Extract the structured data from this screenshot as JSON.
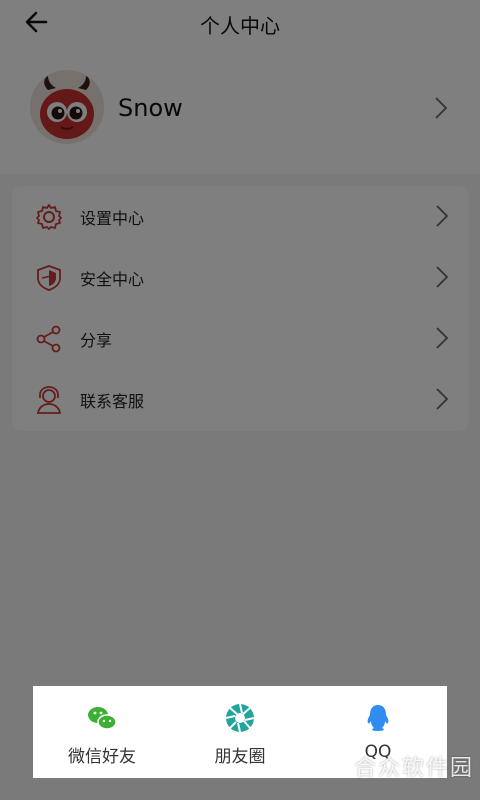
{
  "header": {
    "title": "个人中心"
  },
  "profile": {
    "username": "Snow"
  },
  "menu": [
    {
      "label": "设置中心",
      "icon": "gear-icon"
    },
    {
      "label": "安全中心",
      "icon": "shield-icon"
    },
    {
      "label": "分享",
      "icon": "share-icon"
    },
    {
      "label": "联系客服",
      "icon": "customer-service-icon"
    }
  ],
  "share_sheet": [
    {
      "label": "微信好友",
      "icon": "wechat-icon",
      "color": "#3cb034"
    },
    {
      "label": "朋友圈",
      "icon": "moments-icon",
      "color": "#20a59a"
    },
    {
      "label": "QQ",
      "icon": "qq-icon",
      "color": "#2f8df0"
    }
  ],
  "watermark": "合众软件园",
  "colors": {
    "accent": "#c83a3a",
    "overlay": "rgba(0,0,0,0.5)"
  }
}
